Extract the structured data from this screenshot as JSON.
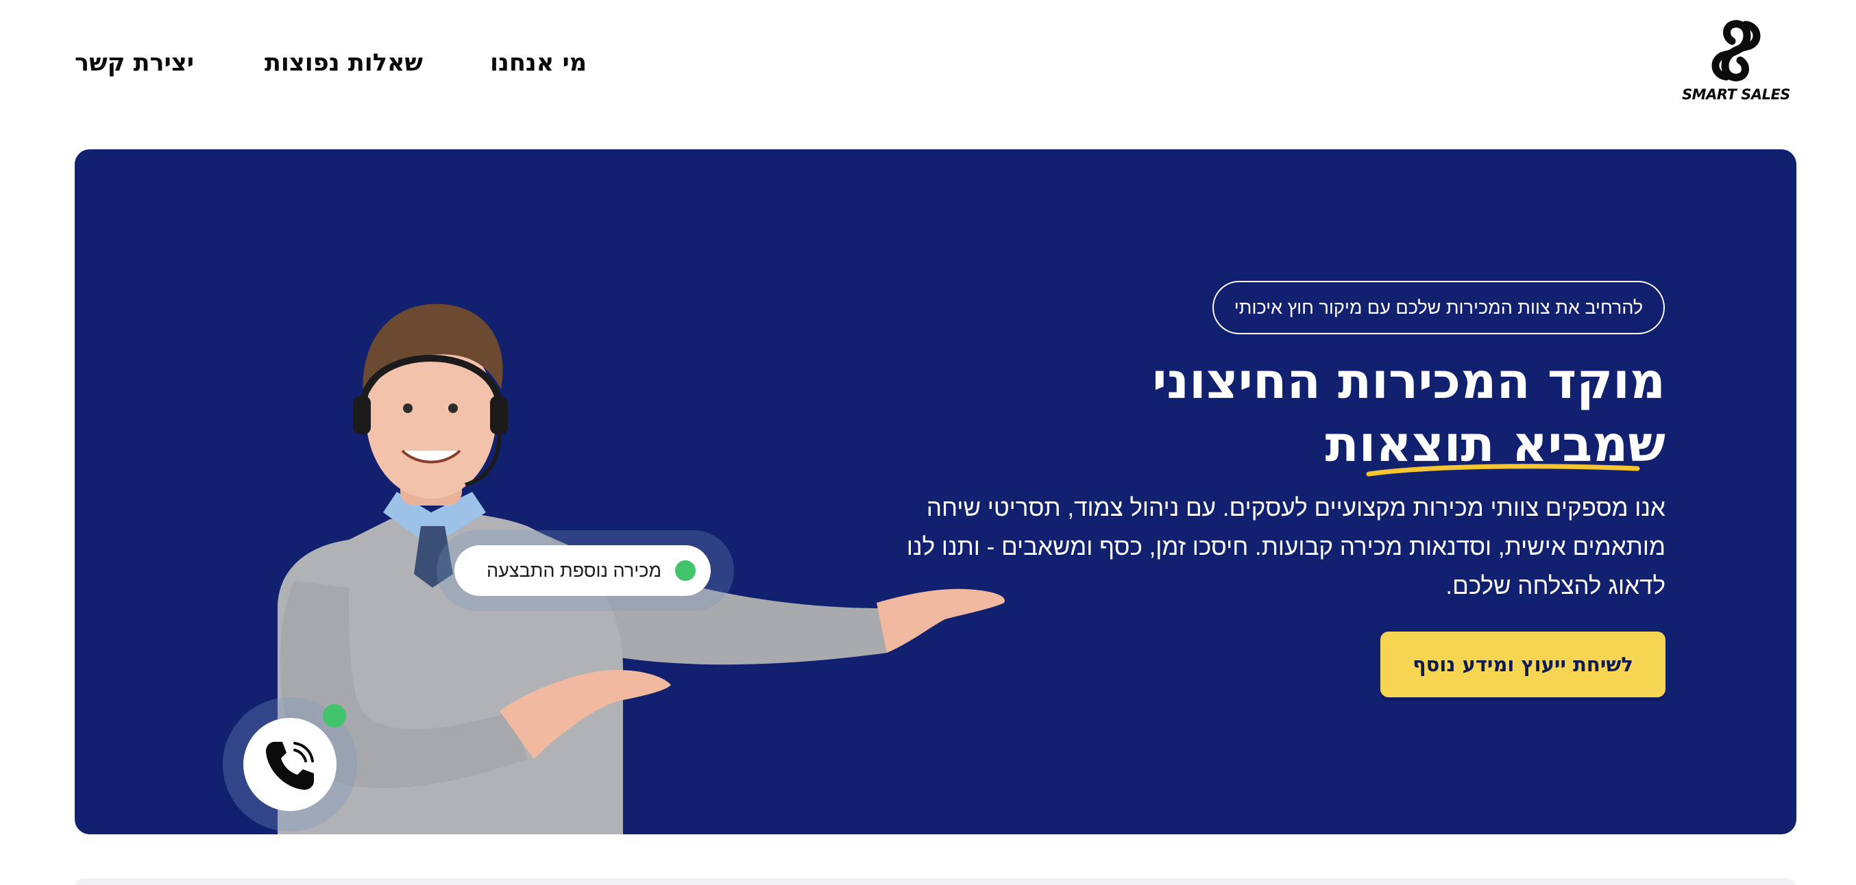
{
  "brand": {
    "name": "SMART SALES"
  },
  "nav": {
    "about": "מי אנחנו",
    "faq": "שאלות נפוצות",
    "contact": "יצירת קשר"
  },
  "hero": {
    "badge": "להרחיב את צוות המכירות שלכם עם מיקור חוץ איכותי",
    "title_line1": "מוקד המכירות החיצוני",
    "title_line2": "שמביא תוצאות",
    "description": "אנו מספקים צוותי מכירות מקצועיים לעסקים. עם ניהול צמוד, תסריטי שיחה מותאמים אישית, וסדנאות מכירה קבועות. חיסכו זמן, כסף ומשאבים - ותנו לנו לדאוג להצלחה שלכם.",
    "cta": "לשיחת ייעוץ ומידע נוסף",
    "sale_notification": "מכירה נוספת התבצעה"
  },
  "colors": {
    "hero_background": "#122070",
    "cta_background": "#f6d553",
    "accent_underline": "#f6c531",
    "status_dot": "#41c46a"
  },
  "icons": {
    "logo": "smart-sales-logo-icon",
    "phone": "phone-ringing-icon"
  }
}
